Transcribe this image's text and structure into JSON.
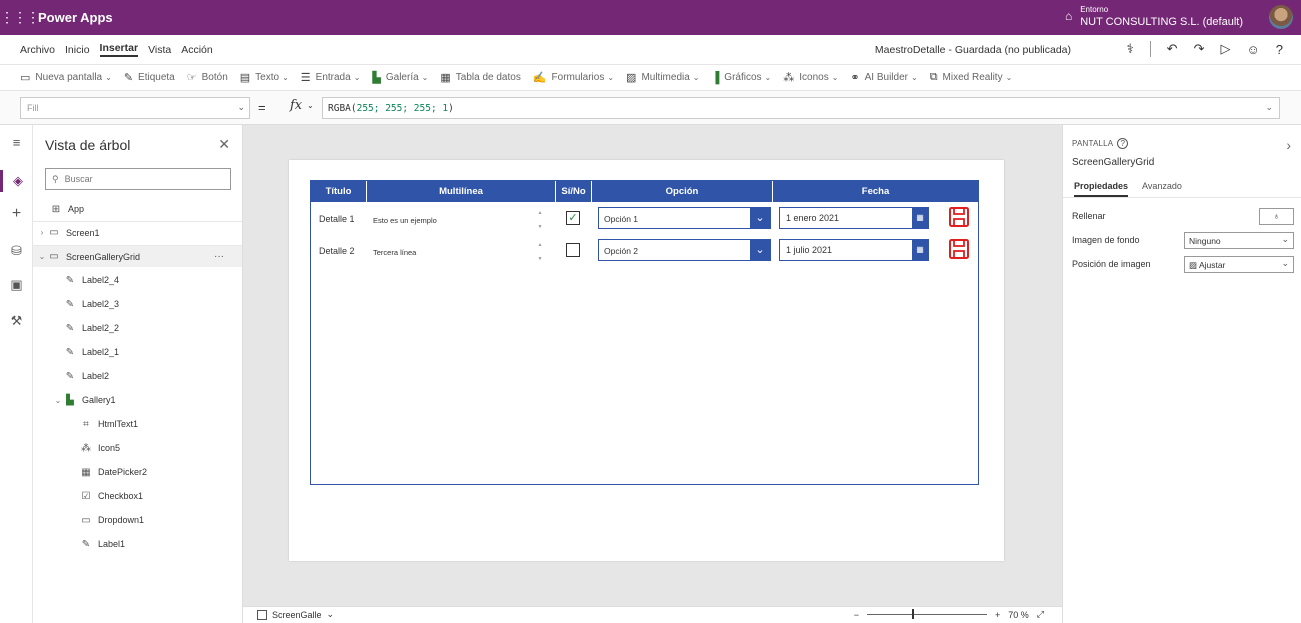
{
  "topbar": {
    "app_name": "Power Apps",
    "env_label": "Entorno",
    "env_name": "NUT CONSULTING S.L. (default)"
  },
  "menu": {
    "items": [
      "Archivo",
      "Inicio",
      "Insertar",
      "Vista",
      "Acción"
    ],
    "active": "Insertar",
    "doc_status": "MaestroDetalle - Guardada (no publicada)"
  },
  "toolbar": {
    "items": [
      {
        "label": "Nueva pantalla",
        "icon": "new-screen-icon",
        "dropdown": true
      },
      {
        "label": "Etiqueta",
        "icon": "label-icon",
        "dropdown": false
      },
      {
        "label": "Botón",
        "icon": "button-icon",
        "dropdown": false
      },
      {
        "label": "Texto",
        "icon": "text-icon",
        "dropdown": true
      },
      {
        "label": "Entrada",
        "icon": "input-icon",
        "dropdown": true
      },
      {
        "label": "Galería",
        "icon": "gallery-icon",
        "dropdown": true
      },
      {
        "label": "Tabla de datos",
        "icon": "data-table-icon",
        "dropdown": false
      },
      {
        "label": "Formularios",
        "icon": "forms-icon",
        "dropdown": true
      },
      {
        "label": "Multimedia",
        "icon": "media-icon",
        "dropdown": true
      },
      {
        "label": "Gráficos",
        "icon": "charts-icon",
        "dropdown": true
      },
      {
        "label": "Iconos",
        "icon": "icons-icon",
        "dropdown": true
      },
      {
        "label": "AI Builder",
        "icon": "ai-builder-icon",
        "dropdown": true
      },
      {
        "label": "Mixed Reality",
        "icon": "mixed-reality-icon",
        "dropdown": true
      }
    ]
  },
  "formula": {
    "property": "Fill",
    "eq": "=",
    "fx": "fx",
    "fn": "RGBA(",
    "args": "255; 255; 255; 1",
    "close": ")"
  },
  "tree": {
    "title": "Vista de árbol",
    "search_placeholder": "Buscar",
    "app_item": "App",
    "items": [
      {
        "label": "Screen1",
        "level": 0,
        "twisty": "›",
        "icon": "screen-icon"
      },
      {
        "label": "ScreenGalleryGrid",
        "level": 0,
        "twisty": "⌄",
        "icon": "screen-icon",
        "selected": true
      },
      {
        "label": "Label2_4",
        "level": 1,
        "icon": "label-icon"
      },
      {
        "label": "Label2_3",
        "level": 1,
        "icon": "label-icon"
      },
      {
        "label": "Label2_2",
        "level": 1,
        "icon": "label-icon"
      },
      {
        "label": "Label2_1",
        "level": 1,
        "icon": "label-icon"
      },
      {
        "label": "Label2",
        "level": 1,
        "icon": "label-icon"
      },
      {
        "label": "Gallery1",
        "level": 1,
        "twisty": "⌄",
        "icon": "gallery-icon"
      },
      {
        "label": "HtmlText1",
        "level": 2,
        "icon": "html-text-icon"
      },
      {
        "label": "Icon5",
        "level": 2,
        "icon": "icons-icon"
      },
      {
        "label": "DatePicker2",
        "level": 2,
        "icon": "date-picker-icon"
      },
      {
        "label": "Checkbox1",
        "level": 2,
        "icon": "checkbox-icon"
      },
      {
        "label": "Dropdown1",
        "level": 2,
        "icon": "dropdown-icon"
      },
      {
        "label": "Label1",
        "level": 2,
        "icon": "label-icon"
      }
    ],
    "more": "···"
  },
  "grid": {
    "headers": [
      "Título",
      "Multilínea",
      "Sí/No",
      "Opción",
      "Fecha"
    ],
    "rows": [
      {
        "title": "Detalle 1",
        "multi": "Esto es un ejemplo",
        "checked": true,
        "option": "Opción 1",
        "date": "1 enero 2021"
      },
      {
        "title": "Detalle 2",
        "multi": "Tercera línea",
        "checked": false,
        "option": "Opción 2",
        "date": "1 julio 2021"
      }
    ],
    "colors": {
      "header": "#3055a8",
      "save": "#e02020"
    }
  },
  "statusbar": {
    "screen": "ScreenGalle",
    "zoom": "70 %"
  },
  "props": {
    "type": "PANTALLA",
    "name": "ScreenGalleryGrid",
    "tabs": [
      "Propiedades",
      "Avanzado"
    ],
    "rows": [
      {
        "label": "Rellenar",
        "value": ""
      },
      {
        "label": "Imagen de fondo",
        "value": "Ninguno"
      },
      {
        "label": "Posición de imagen",
        "value": "Ajustar"
      }
    ]
  },
  "theme": {
    "brand": "#742774"
  }
}
